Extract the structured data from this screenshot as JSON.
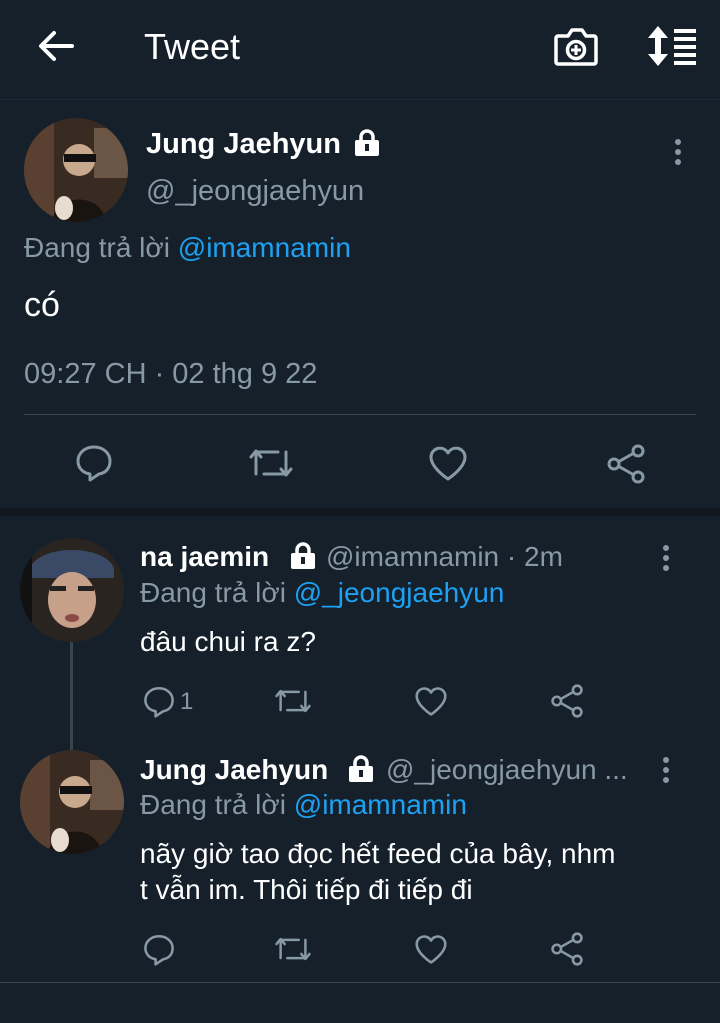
{
  "header": {
    "title": "Tweet"
  },
  "main_tweet": {
    "name": "Jung Jaehyun",
    "handle": "@_jeongjaehyun",
    "reply_prefix": "Đang trả lời",
    "reply_to": "@imamnamin",
    "text": "có",
    "timestamp": "09:27 CH · 02 thg 9 22"
  },
  "replies": [
    {
      "name": "na jaemin",
      "handle_time": "@imamnamin · 2m",
      "reply_prefix": "Đang trả lời",
      "reply_to": "@_jeongjaehyun",
      "text": "đâu chui ra z?",
      "reply_count": "1"
    },
    {
      "name": "Jung Jaehyun",
      "handle_time": "@_jeongjaehyun ...",
      "reply_prefix": "Đang trả lời",
      "reply_to": "@imamnamin",
      "text_line1": "nãy giờ tao đọc hết feed của bây, nhm",
      "text_line2": "t vẫn im. Thôi tiếp đi tiếp đi"
    }
  ],
  "colors": {
    "background": "#15202b",
    "accent": "#1da1f2",
    "muted": "#8899a6",
    "divider": "#38444d"
  }
}
